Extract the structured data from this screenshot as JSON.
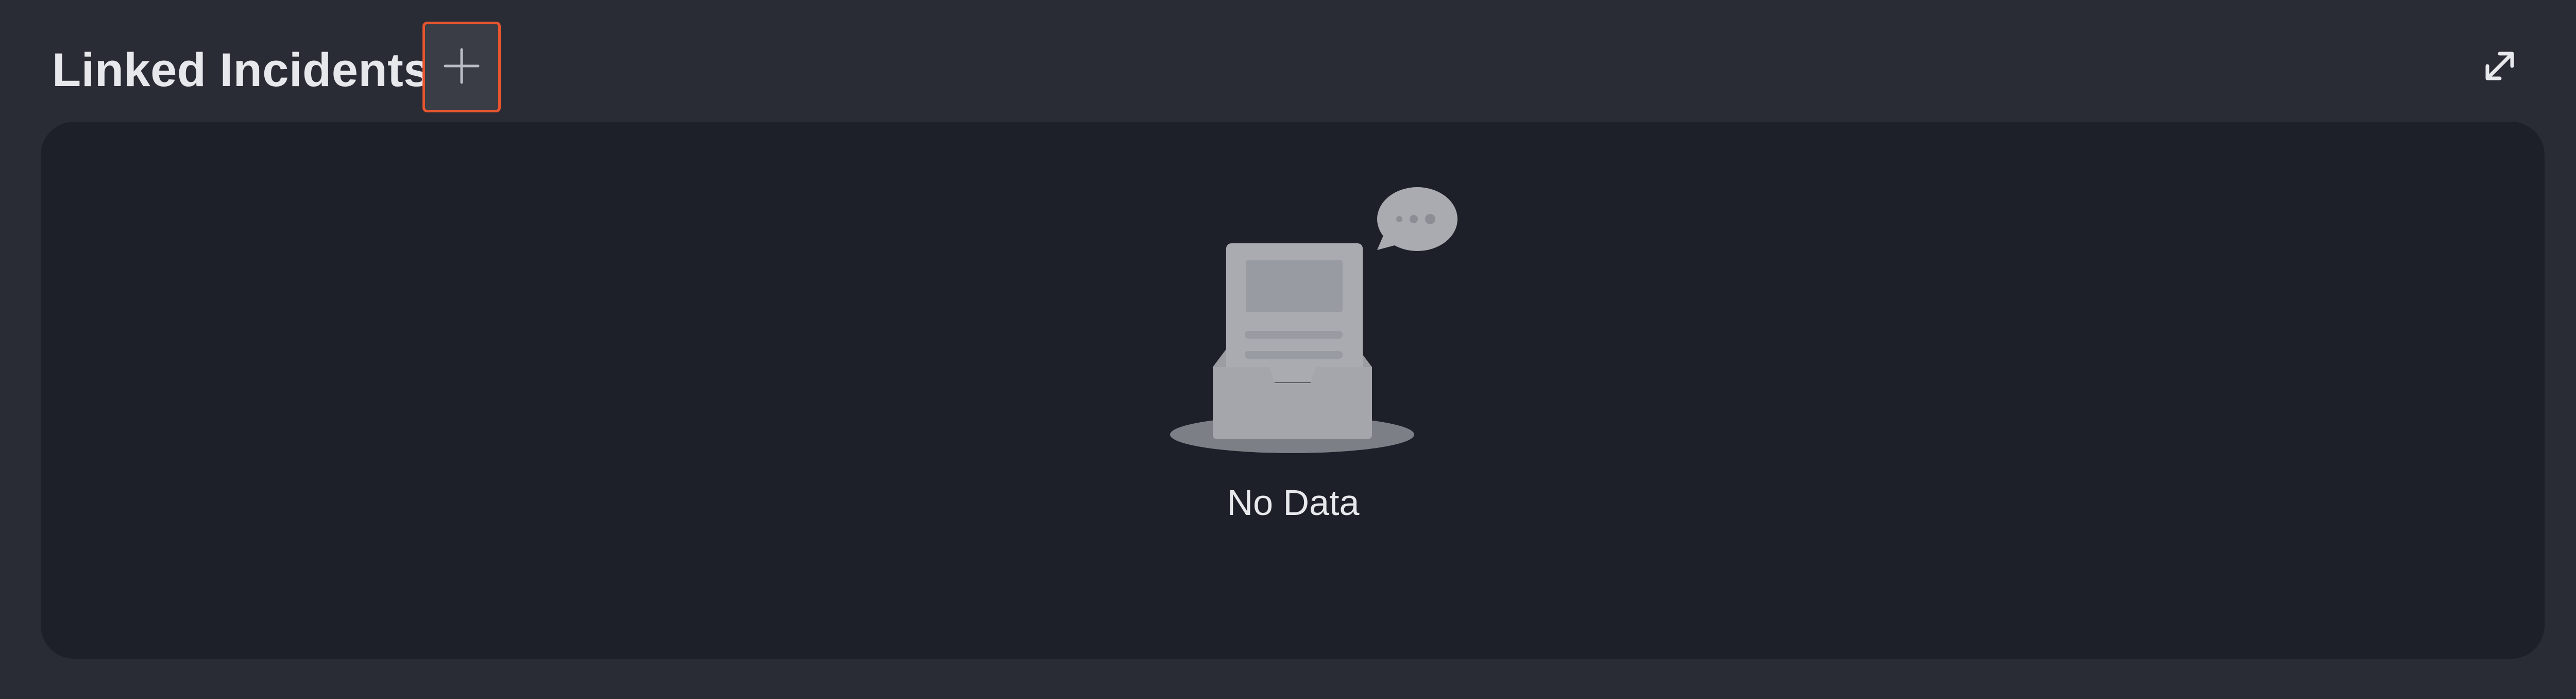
{
  "section": {
    "title": "Linked Incidents",
    "add_icon": "plus-icon",
    "expand_icon": "expand-icon"
  },
  "empty_state": {
    "illustration_icon": "empty-inbox-icon",
    "message": "No Data"
  },
  "colors": {
    "background": "#292c34",
    "panel": "#1e2029",
    "accent_border": "#e8552f",
    "text": "#e6e8ec"
  }
}
